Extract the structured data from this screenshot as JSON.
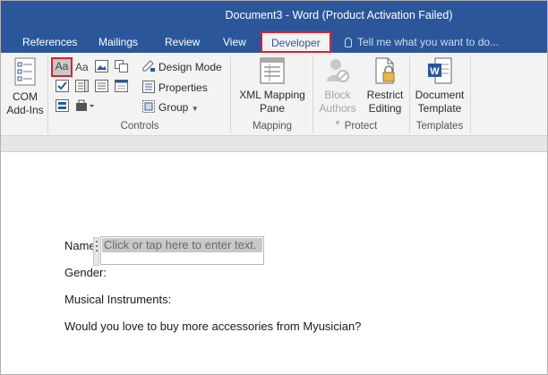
{
  "window": {
    "title": "Document3 - Word (Product Activation Failed)"
  },
  "tabs": [
    {
      "label": "References"
    },
    {
      "label": "Mailings"
    },
    {
      "label": "Review"
    },
    {
      "label": "View"
    },
    {
      "label": "Developer",
      "active": true,
      "highlighted": true
    }
  ],
  "tell_me": {
    "placeholder": "Tell me what you want to do..."
  },
  "ribbon": {
    "addins": {
      "com_addins_line1": "COM",
      "com_addins_line2": "Add-Ins"
    },
    "controls": {
      "group_label": "Controls",
      "design_mode": "Design Mode",
      "properties": "Properties",
      "group": "Group",
      "rich_text_glyph": "Aa",
      "plain_text_glyph": "Aa"
    },
    "mapping": {
      "group_label": "Mapping",
      "xml_line1": "XML Mapping",
      "xml_line2": "Pane"
    },
    "protect": {
      "group_label": "Protect",
      "block_line1": "Block",
      "block_line2": "Authors",
      "restrict_line1": "Restrict",
      "restrict_line2": "Editing"
    },
    "templates": {
      "group_label": "Templates",
      "doc_line1": "Document",
      "doc_line2": "Template"
    }
  },
  "document": {
    "name_label": "Name:",
    "content_control_placeholder": "Click or tap here to enter text.",
    "gender_label": "Gender:",
    "instruments_label": "Musical Instruments:",
    "question": "Would you love to buy more accessories from Myusician?"
  },
  "colors": {
    "title_bar": "#2b579a",
    "ribbon": "#f3f3f3",
    "highlight": "#e0202a",
    "word_blue": "#2b579a"
  },
  "icons": [
    "com-addins-icon",
    "rich-text-control-icon",
    "plain-text-control-icon",
    "picture-control-icon",
    "building-block-icon",
    "checkbox-control-icon",
    "combo-box-icon",
    "dropdown-list-icon",
    "date-picker-icon",
    "repeating-section-icon",
    "legacy-tools-icon",
    "design-mode-icon",
    "properties-icon",
    "group-icon",
    "xml-mapping-pane-icon",
    "block-authors-icon",
    "restrict-editing-icon",
    "document-template-icon"
  ]
}
